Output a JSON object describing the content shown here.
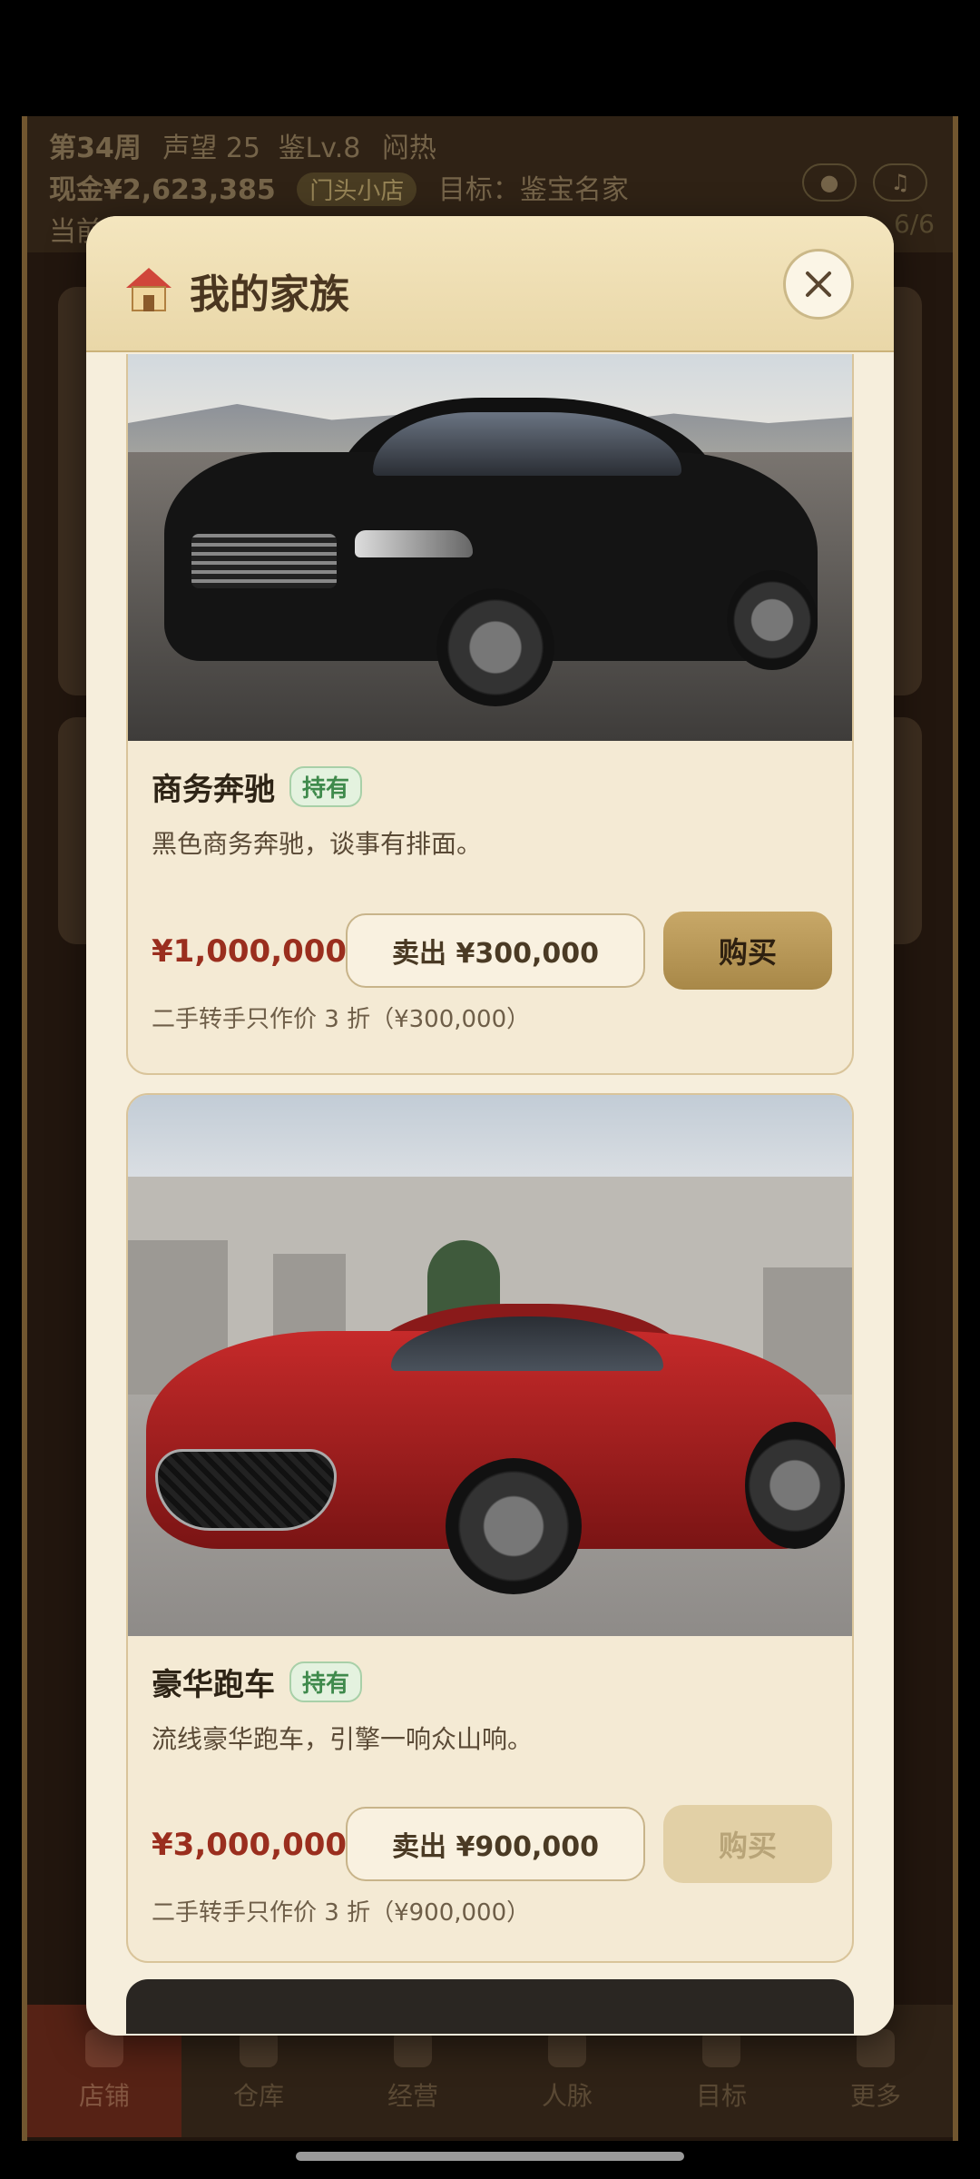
{
  "hud": {
    "week": "第34周",
    "reputation": "声望 25",
    "appraisal": "鉴Lv.8",
    "mood": "闷热",
    "cash": "现金¥2,623,385",
    "shop_tier": "门头小店",
    "goal": "目标：鉴宝名家",
    "line3": "当前",
    "line3_right": "6/6"
  },
  "modal": {
    "title": "我的家族",
    "close_icon": "close-icon"
  },
  "items": [
    {
      "name": "商务奔驰",
      "badge": "持有",
      "desc": "黑色商务奔驰，谈事有排面。",
      "price": "¥1,000,000",
      "sell_label": "卖出 ¥300,000",
      "buy_label": "购买",
      "buy_enabled": true,
      "note": "二手转手只作价 3 折（¥300,000）"
    },
    {
      "name": "豪华跑车",
      "badge": "持有",
      "desc": "流线豪华跑车，引擎一响众山响。",
      "price": "¥3,000,000",
      "sell_label": "卖出 ¥900,000",
      "buy_label": "购买",
      "buy_enabled": false,
      "note": "二手转手只作价 3 折（¥900,000）"
    }
  ],
  "nav": [
    "店铺",
    "仓库",
    "经营",
    "人脉",
    "目标",
    "更多"
  ],
  "colors": {
    "modal_bg": "#f6eedc",
    "price": "#9a2e1e",
    "buy_button": "#b8985a",
    "owned_badge": "#3f8a4c"
  }
}
